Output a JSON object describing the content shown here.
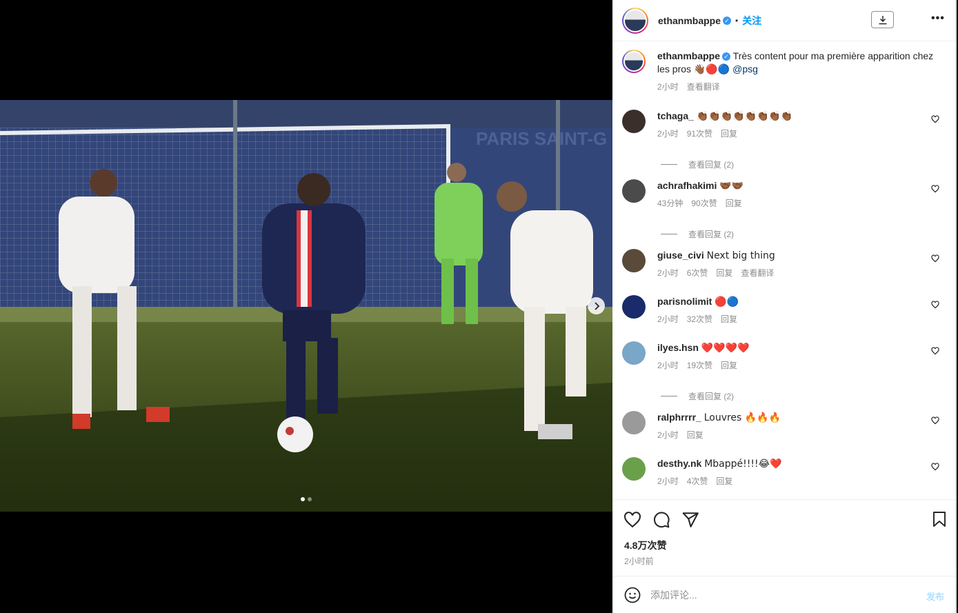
{
  "post": {
    "username": "ethanmbappe",
    "follow_label": "关注",
    "caption_text": "Très content pour ma première apparition chez les pros",
    "caption_emojis": "👋🏾🔴🔵",
    "caption_mention": "@psg",
    "caption_time": "2小时",
    "caption_translate": "查看翻译",
    "carousel_index": 1,
    "carousel_count": 2
  },
  "comments": [
    {
      "user": "tchaga_",
      "text": "👏🏾👏🏾👏🏾👏🏾👏🏾👏🏾👏🏾👏🏾",
      "time": "2小时",
      "likes": "91次赞",
      "reply": "回复",
      "extra": "",
      "view_replies": "查看回复 (2)",
      "avatar_color": "#3a2f2a"
    },
    {
      "user": "achrafhakimi",
      "text": "🤝🏾🤝🏾",
      "time": "43分钟",
      "likes": "90次赞",
      "reply": "回复",
      "extra": "",
      "view_replies": "查看回复 (2)",
      "avatar_color": "#4b4b4b"
    },
    {
      "user": "giuse_civi",
      "text": "Next big thing",
      "time": "2小时",
      "likes": "6次赞",
      "reply": "回复",
      "extra": "查看翻译",
      "view_replies": "",
      "avatar_color": "#5a4a3a"
    },
    {
      "user": "parisnolimit",
      "text": "🔴🔵",
      "time": "2小时",
      "likes": "32次赞",
      "reply": "回复",
      "extra": "",
      "view_replies": "",
      "avatar_color": "#1a2a6a"
    },
    {
      "user": "ilyes.hsn",
      "text": "❤️❤️❤️❤️",
      "time": "2小时",
      "likes": "19次赞",
      "reply": "回复",
      "extra": "",
      "view_replies": "查看回复 (2)",
      "avatar_color": "#7aa6c8"
    },
    {
      "user": "ralphrrrr_",
      "text": "Louvres 🔥🔥🔥",
      "time": "2小时",
      "likes": "",
      "reply": "回复",
      "extra": "",
      "view_replies": "",
      "avatar_color": "#9a9a9a"
    },
    {
      "user": "desthy.nk",
      "text": "Mbappé!!!!😂❤️",
      "time": "2小时",
      "likes": "4次赞",
      "reply": "回复",
      "extra": "",
      "view_replies": "",
      "avatar_color": "#6aa04a"
    }
  ],
  "actions": {
    "like_count": "4.8万次赞",
    "posted_ago": "2小时前"
  },
  "composer": {
    "placeholder": "添加评论...",
    "post_label": "发布"
  },
  "colors": {
    "accent": "#0095f6",
    "verified": "#3897f0",
    "muted": "#8e8e8e",
    "post_disabled": "#b2dffc"
  }
}
